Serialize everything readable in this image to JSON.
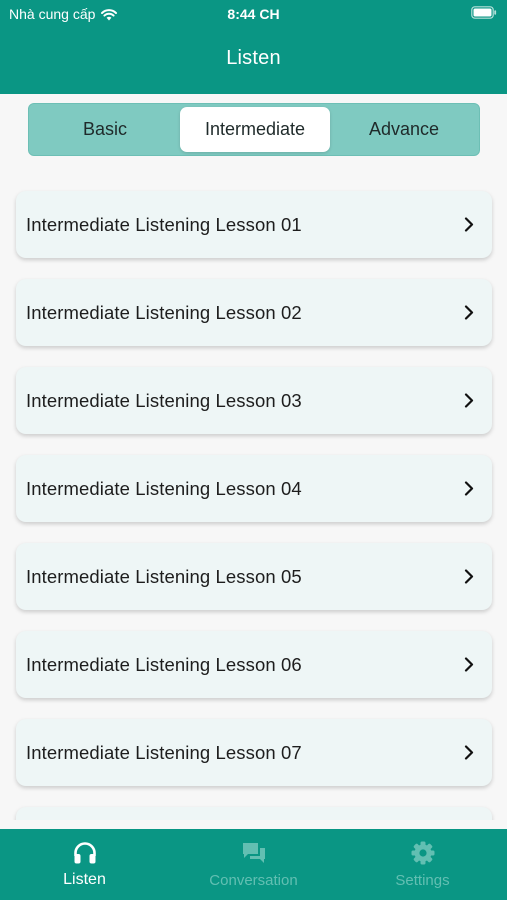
{
  "status_bar": {
    "carrier": "Nhà cung cấp",
    "time": "8:44 CH"
  },
  "header": {
    "title": "Listen"
  },
  "segments": [
    {
      "label": "Basic",
      "selected": false
    },
    {
      "label": "Intermediate",
      "selected": true
    },
    {
      "label": "Advance",
      "selected": false
    }
  ],
  "lessons": [
    {
      "label": "Intermediate Listening Lesson 01"
    },
    {
      "label": "Intermediate Listening Lesson 02"
    },
    {
      "label": "Intermediate Listening Lesson 03"
    },
    {
      "label": "Intermediate Listening Lesson 04"
    },
    {
      "label": "Intermediate Listening Lesson 05"
    },
    {
      "label": "Intermediate Listening Lesson 06"
    },
    {
      "label": "Intermediate Listening Lesson 07"
    },
    {
      "label": ""
    }
  ],
  "tabbar": {
    "items": [
      {
        "label": "Listen",
        "icon": "headphones-icon",
        "active": true
      },
      {
        "label": "Conversation",
        "icon": "chat-bubbles-icon",
        "active": false
      },
      {
        "label": "Settings",
        "icon": "gear-icon",
        "active": false
      }
    ]
  },
  "colors": {
    "primary": "#0a9684",
    "segment_bg": "#7fcac1",
    "card_bg": "#eef6f6",
    "tab_inactive": "#62bfb2"
  }
}
